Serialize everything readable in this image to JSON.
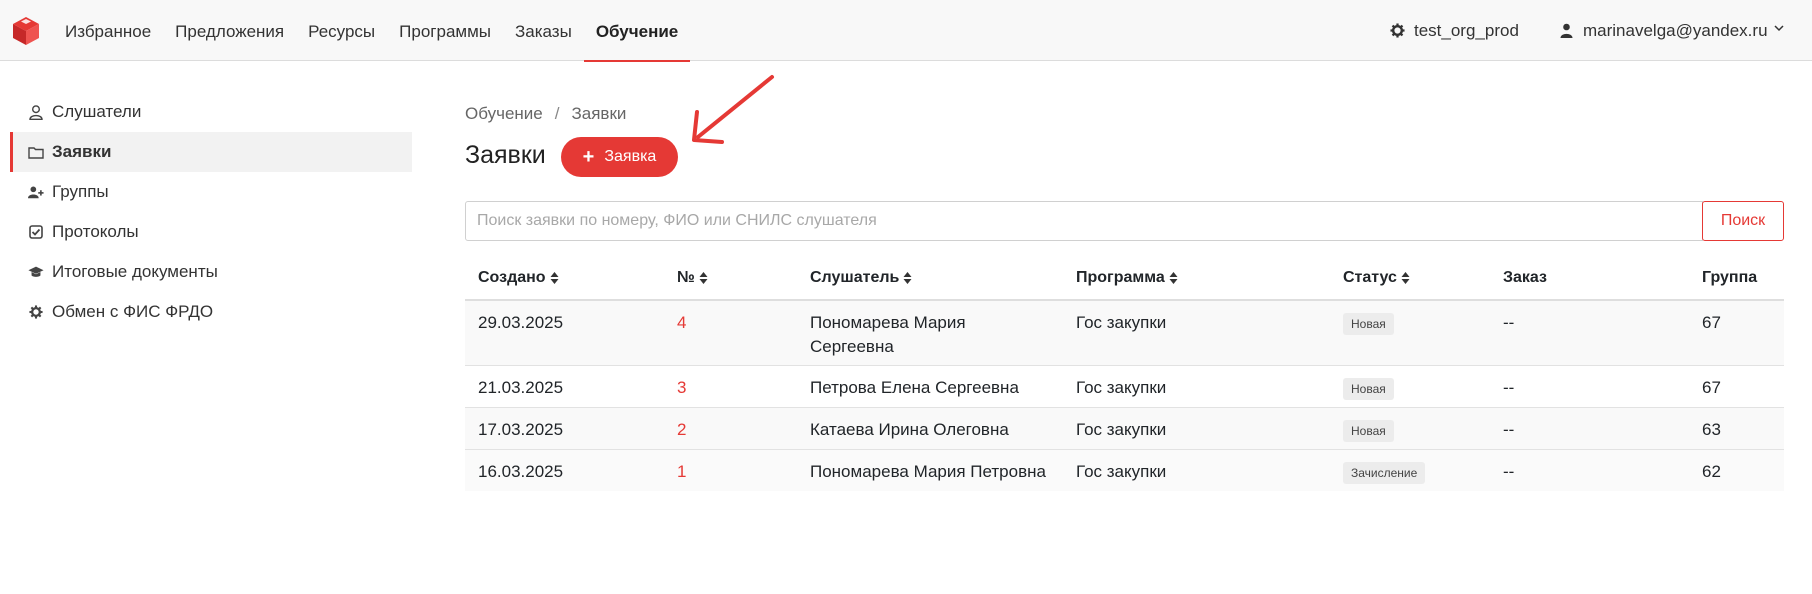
{
  "nav": {
    "items": [
      {
        "label": "Избранное",
        "active": false
      },
      {
        "label": "Предложения",
        "active": false
      },
      {
        "label": "Ресурсы",
        "active": false
      },
      {
        "label": "Программы",
        "active": false
      },
      {
        "label": "Заказы",
        "active": false
      },
      {
        "label": "Обучение",
        "active": true
      }
    ],
    "org": "test_org_prod",
    "user": "marinavelga@yandex.ru"
  },
  "sidebar": {
    "items": [
      {
        "label": "Слушатели",
        "icon": "user-icon"
      },
      {
        "label": "Заявки",
        "icon": "folder-icon",
        "active": true
      },
      {
        "label": "Группы",
        "icon": "user-plus-icon"
      },
      {
        "label": "Протоколы",
        "icon": "checkbox-icon"
      },
      {
        "label": "Итоговые документы",
        "icon": "graduation-cap-icon"
      },
      {
        "label": "Обмен с ФИС ФРДО",
        "icon": "gear-icon"
      }
    ]
  },
  "breadcrumb": {
    "parent": "Обучение",
    "separator": "/",
    "current": "Заявки"
  },
  "page": {
    "title": "Заявки",
    "add_button": "Заявка"
  },
  "search": {
    "placeholder": "Поиск заявки по номеру, ФИО или СНИЛС слушателя",
    "value": "",
    "button": "Поиск"
  },
  "table": {
    "columns": [
      "Создано",
      "№",
      "Слушатель",
      "Программа",
      "Статус",
      "Заказ",
      "Группа"
    ],
    "rows": [
      {
        "created": "29.03.2025",
        "num": "4",
        "student_line1": "Пономарева Мария",
        "student_line2": "Сергеевна",
        "program": "Гос закупки",
        "status": "Новая",
        "order": "--",
        "group": "67"
      },
      {
        "created": "21.03.2025",
        "num": "3",
        "student_line1": "Петрова Елена Сергеевна",
        "student_line2": "",
        "program": "Гос закупки",
        "status": "Новая",
        "order": "--",
        "group": "67"
      },
      {
        "created": "17.03.2025",
        "num": "2",
        "student_line1": "Катаева Ирина Олеговна",
        "student_line2": "",
        "program": "Гос закупки",
        "status": "Новая",
        "order": "--",
        "group": "63"
      },
      {
        "created": "16.03.2025",
        "num": "1",
        "student_line1": "Пономарева Мария Петровна",
        "student_line2": "",
        "program": "Гос закупки",
        "status": "Зачисление",
        "order": "--",
        "group": "62"
      }
    ]
  },
  "colors": {
    "accent": "#e53935",
    "topbar": "#f8f8f8",
    "badge": "#ececec"
  }
}
